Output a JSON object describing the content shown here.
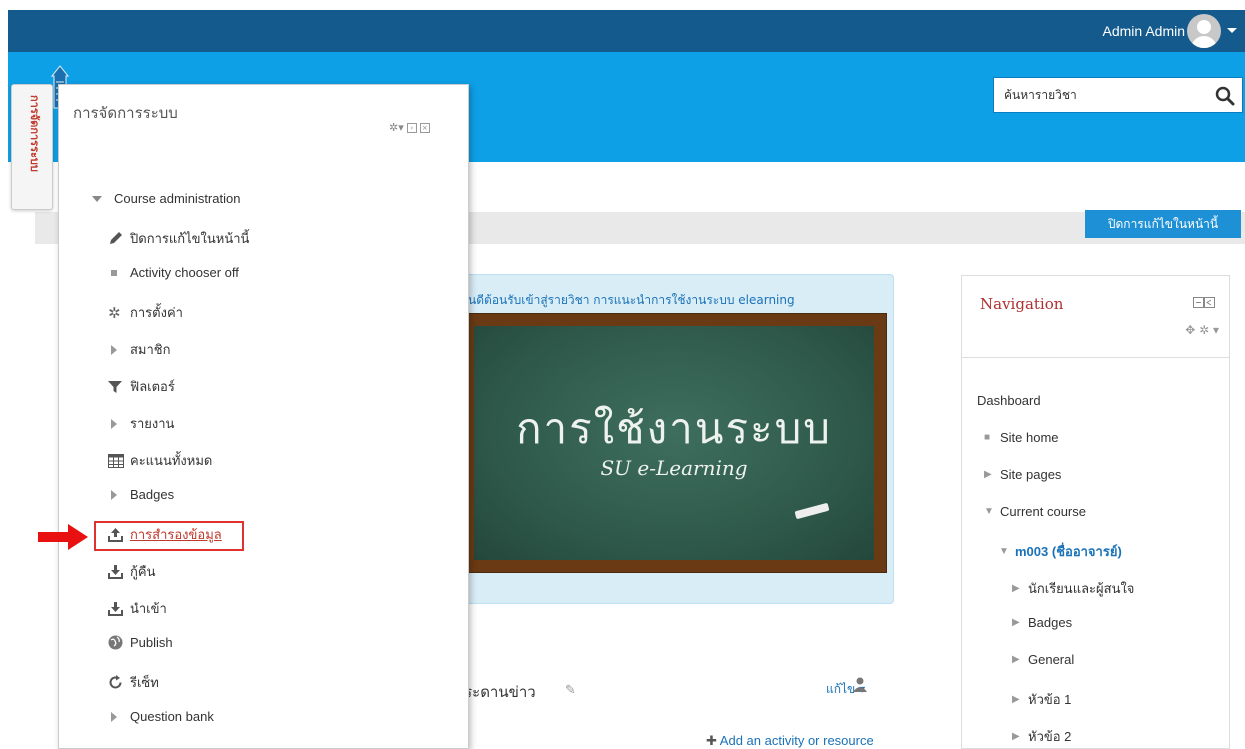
{
  "topbar": {
    "user_name": "Admin Admin"
  },
  "header": {
    "search_placeholder": "ค้นหารายวิชา"
  },
  "toolbar": {
    "edit_toggle_label": "ปิดการแก้ไขในหน้านี้"
  },
  "admin_dock": {
    "label": "การจัดการระบบ"
  },
  "admin_panel": {
    "title": "การจัดการระบบ",
    "items": [
      {
        "label": "Course administration",
        "icon": "chevron-down-icon"
      },
      {
        "label": "ปิดการแก้ไขในหน้านี้",
        "icon": "pencil-icon"
      },
      {
        "label": "Activity chooser off",
        "icon": "bullet-icon"
      },
      {
        "label": "การตั้งค่า",
        "icon": "gear-icon"
      },
      {
        "label": "สมาชิก",
        "icon": "chevron-right-icon"
      },
      {
        "label": "ฟิลเตอร์",
        "icon": "filter-icon"
      },
      {
        "label": "รายงาน",
        "icon": "chevron-right-icon"
      },
      {
        "label": "คะแนนทั้งหมด",
        "icon": "table-icon"
      },
      {
        "label": "Badges",
        "icon": "chevron-right-icon"
      },
      {
        "label": "การสำรองข้อมูล",
        "icon": "upload-icon"
      },
      {
        "label": "กู้คืน",
        "icon": "download-icon"
      },
      {
        "label": "นำเข้า",
        "icon": "import-icon"
      },
      {
        "label": "Publish",
        "icon": "globe-icon"
      },
      {
        "label": "รีเซ็ท",
        "icon": "reset-icon"
      },
      {
        "label": "Question bank",
        "icon": "chevron-right-icon"
      }
    ]
  },
  "course": {
    "welcome": "ยินดีต้อนรับเข้าสู่รายวิชา การแนะนำการใช้งานระบบ elearning",
    "board_title": "การใช้งานระบบ",
    "board_subtitle": "SU e-Learning",
    "news_title": "กระดานข่าว",
    "edit_label": "แก้ไข",
    "add_activity": "Add an activity or resource"
  },
  "navigation": {
    "title": "Navigation",
    "items": [
      {
        "label": "Dashboard"
      },
      {
        "label": "Site home"
      },
      {
        "label": "Site pages"
      },
      {
        "label": "Current course"
      },
      {
        "label": "m003 (ชื่ออาจารย์)"
      },
      {
        "label": "นักเรียนและผู้สนใจ"
      },
      {
        "label": "Badges"
      },
      {
        "label": "General"
      },
      {
        "label": "หัวข้อ 1"
      },
      {
        "label": "หัวข้อ 2"
      }
    ]
  },
  "colors": {
    "topbar": "#145a8c",
    "header": "#0ea0e6",
    "accent": "#1a72b8",
    "highlight": "#e03030"
  }
}
